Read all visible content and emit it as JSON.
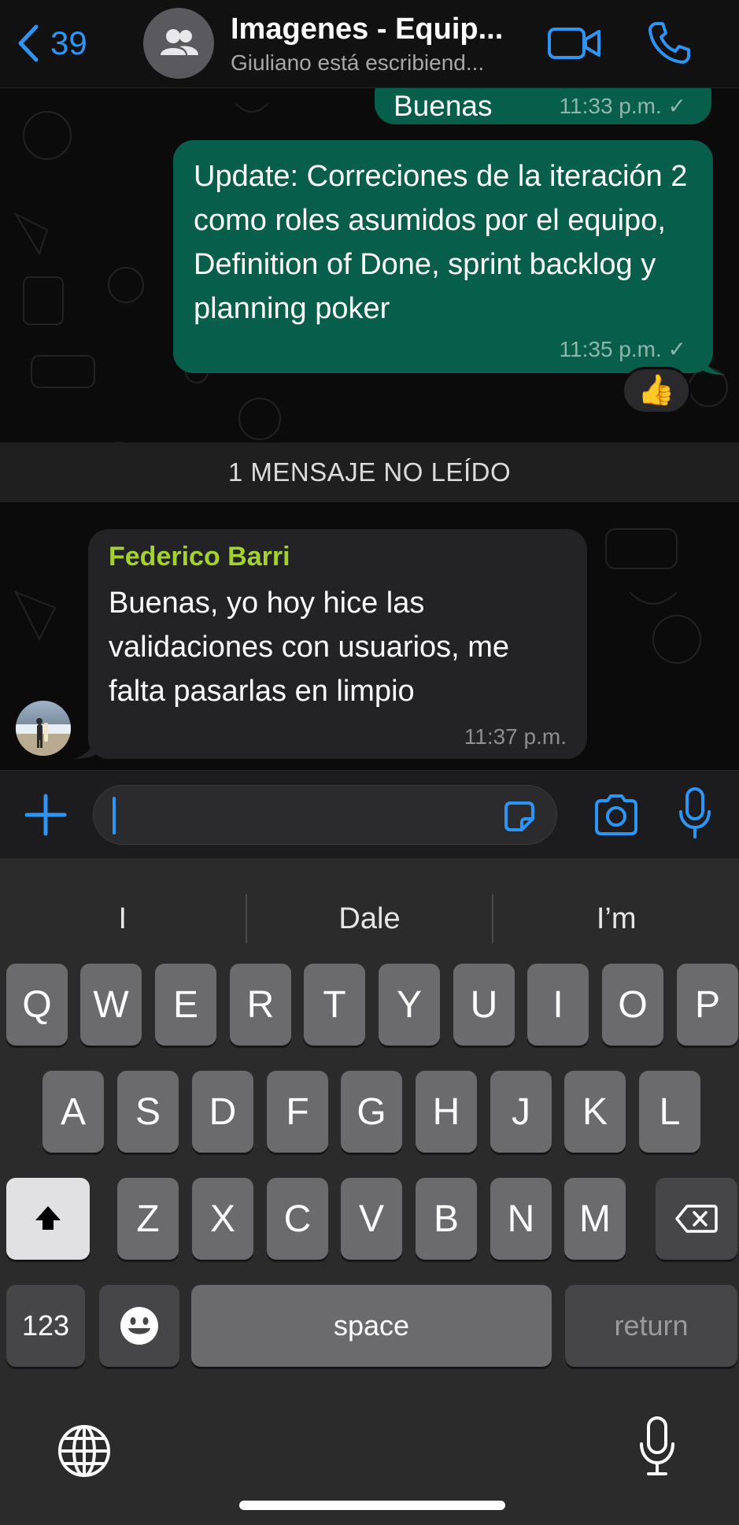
{
  "header": {
    "back_count": "39",
    "title": "Imagenes - Equip...",
    "subtitle": "Giuliano está escribiend...",
    "accent": "#2f95f5"
  },
  "messages": {
    "out1": {
      "text": "Buenas",
      "time": "11:33 p.m. ✓"
    },
    "out2": {
      "text": "Update: Correciones de la iteración 2 como roles asumidos por el equipo, Definition of Done, sprint backlog y planning poker",
      "time": "11:35 p.m. ✓",
      "reaction": "👍"
    },
    "unread_banner": "1 MENSAJE NO LEÍDO",
    "in1": {
      "sender": "Federico Barri",
      "text": "Buenas, yo hoy hice las validaciones con usuarios, me falta pasarlas en limpio",
      "time": "11:37 p.m."
    }
  },
  "keyboard": {
    "suggestions": [
      "I",
      "Dale",
      "I’m"
    ],
    "row1": [
      "Q",
      "W",
      "E",
      "R",
      "T",
      "Y",
      "U",
      "I",
      "O",
      "P"
    ],
    "row2": [
      "A",
      "S",
      "D",
      "F",
      "G",
      "H",
      "J",
      "K",
      "L"
    ],
    "row3": [
      "Z",
      "X",
      "C",
      "V",
      "B",
      "N",
      "M"
    ],
    "numbers_label": "123",
    "space_label": "space",
    "return_label": "return"
  }
}
